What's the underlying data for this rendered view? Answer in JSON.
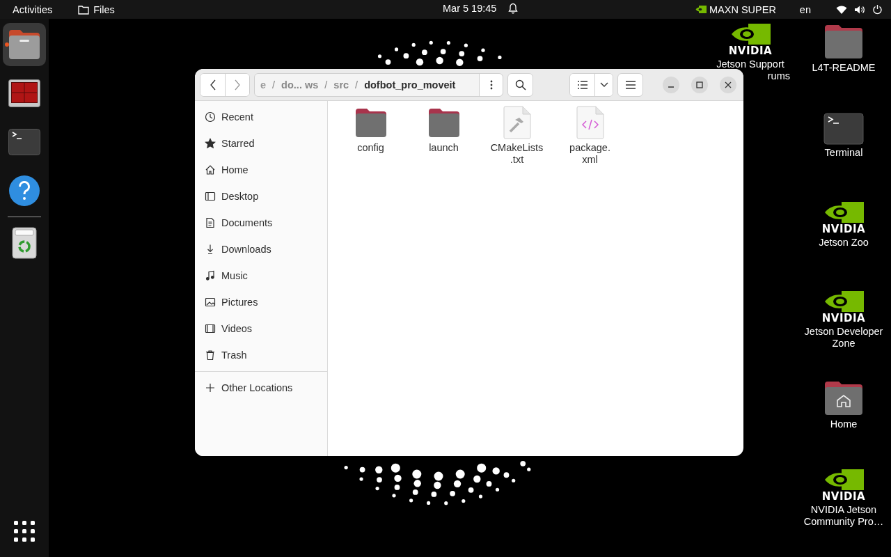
{
  "top_bar": {
    "activities": "Activities",
    "app_menu": "Files",
    "clock": "Mar 5  19:45",
    "performance_mode": "MAXN SUPER",
    "keyboard_layout": "en"
  },
  "dock": {
    "apps": [
      {
        "kind": "files",
        "running": true
      },
      {
        "kind": "workspaces",
        "running": false
      },
      {
        "kind": "terminal",
        "running": false
      },
      {
        "kind": "help",
        "running": false
      },
      {
        "kind": "trash",
        "running": false
      }
    ]
  },
  "desktop_columns": [
    [
      {
        "kind": "nvidia",
        "logo": "NVIDIA",
        "label": "Jetson Support",
        "label_rest": "rums"
      }
    ],
    [
      {
        "kind": "folder",
        "label": "L4T-README"
      },
      {
        "kind": "terminal",
        "label": "Terminal"
      },
      {
        "kind": "nvidia",
        "logo": "NVIDIA",
        "label": "Jetson Zoo"
      },
      {
        "kind": "nvidia",
        "logo": "NVIDIA",
        "label": "Jetson Developer Zone"
      },
      {
        "kind": "home",
        "label": "Home"
      },
      {
        "kind": "nvidia",
        "logo": "NVIDIA",
        "label": "NVIDIA Jetson Community Pro…"
      }
    ]
  ],
  "window": {
    "pathbar": {
      "separator": "/",
      "segments": [
        {
          "label": "e",
          "selected": false
        },
        {
          "label": "do... ws",
          "selected": false
        },
        {
          "label": "src",
          "selected": false
        },
        {
          "label": "dofbot_pro_moveit",
          "selected": true
        }
      ]
    },
    "sidebar": {
      "places": [
        {
          "kind": "recent",
          "label": "Recent"
        },
        {
          "kind": "starred",
          "label": "Starred"
        },
        {
          "kind": "home",
          "label": "Home"
        },
        {
          "kind": "desktop",
          "label": "Desktop"
        },
        {
          "kind": "documents",
          "label": "Documents"
        },
        {
          "kind": "downloads",
          "label": "Downloads"
        },
        {
          "kind": "music",
          "label": "Music"
        },
        {
          "kind": "pictures",
          "label": "Pictures"
        },
        {
          "kind": "videos",
          "label": "Videos"
        },
        {
          "kind": "trash",
          "label": "Trash"
        }
      ],
      "other_locations": "Other Locations"
    },
    "files": [
      {
        "kind": "folder",
        "name_lines": [
          "config"
        ]
      },
      {
        "kind": "folder",
        "name_lines": [
          "launch"
        ]
      },
      {
        "kind": "cmake",
        "name_lines": [
          "CMakeLists",
          ".txt"
        ]
      },
      {
        "kind": "xml",
        "name_lines": [
          "package.",
          "xml"
        ]
      }
    ]
  }
}
